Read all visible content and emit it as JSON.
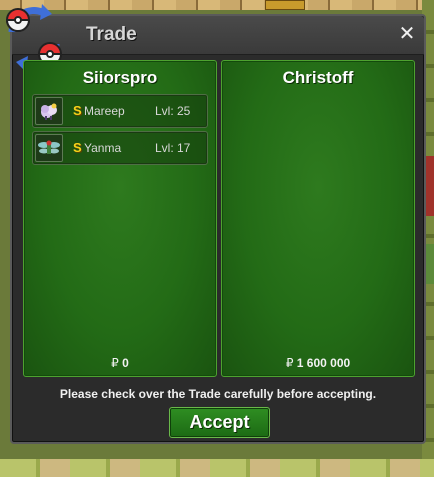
{
  "dialog": {
    "title": "Trade",
    "close_label": "✕"
  },
  "left_panel": {
    "name": "Siiorspro",
    "items": [
      {
        "shiny_mark": "S",
        "name": "Mareep",
        "level": "Lvl: 25",
        "icon": "mareep-sprite-icon"
      },
      {
        "shiny_mark": "S",
        "name": "Yanma",
        "level": "Lvl: 17",
        "icon": "yanma-sprite-icon"
      }
    ],
    "money_symbol": "₽",
    "money": "0"
  },
  "right_panel": {
    "name": "Christoff",
    "items": [],
    "money_symbol": "₽",
    "money": "1 600 000"
  },
  "notice": "Please check over the Trade carefully before accepting.",
  "accept_label": "Accept",
  "colors": {
    "panel_green": "#236b16",
    "shiny_gold": "#f5d21a",
    "dialog_bg": "#2b2b2b"
  }
}
